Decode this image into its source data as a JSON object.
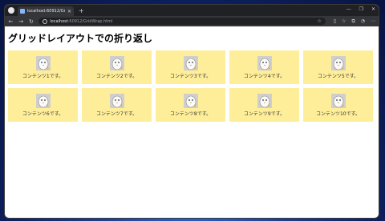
{
  "browser": {
    "tab_title": "localhost:60912/GridWrap.html",
    "tab_close": "✕",
    "new_tab": "+",
    "window_controls": [
      "—",
      "❐",
      "✕"
    ],
    "url_host": "localhost",
    "url_path": ":60912/GridWrap.html"
  },
  "page": {
    "title": "グリッドレイアウトでの折り返し",
    "items": [
      "コンテンツ1です。",
      "コンテンツ2です。",
      "コンテンツ3です。",
      "コンテンツ4です。",
      "コンテンツ5です。",
      "コンテンツ6です。",
      "コンテンツ7です。",
      "コンテンツ8です。",
      "コンテンツ9です。",
      "コンテンツ10です。"
    ]
  },
  "colors": {
    "cell_bg": "#ffee99",
    "browser_chrome": "#202124",
    "toolbar": "#35363a"
  },
  "icons": [
    "back-icon",
    "forward-icon",
    "reload-icon",
    "info-icon",
    "star-icon",
    "mascot-image"
  ]
}
